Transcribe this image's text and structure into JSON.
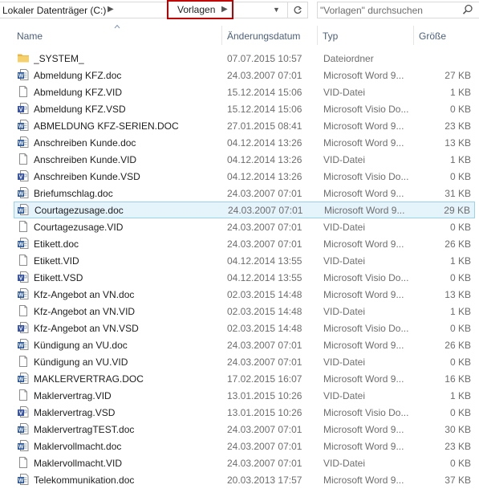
{
  "address": {
    "root_crumb": "Lokaler Datenträger (C:)",
    "current_crumb": "Vorlagen"
  },
  "search": {
    "placeholder": "\"Vorlagen\" durchsuchen"
  },
  "columns": {
    "name": "Name",
    "date": "Änderungsdatum",
    "type": "Typ",
    "size": "Größe"
  },
  "files": [
    {
      "name": "_SYSTEM_",
      "date": "07.07.2015 10:57",
      "type": "Dateiordner",
      "size": "",
      "icon": "folder-icon"
    },
    {
      "name": "Abmeldung KFZ.doc",
      "date": "24.03.2007 07:01",
      "type": "Microsoft Word 9...",
      "size": "27 KB",
      "icon": "word-doc-icon"
    },
    {
      "name": "Abmeldung KFZ.VID",
      "date": "15.12.2014 15:06",
      "type": "VID-Datei",
      "size": "1 KB",
      "icon": "blank-file-icon"
    },
    {
      "name": "Abmeldung KFZ.VSD",
      "date": "15.12.2014 15:06",
      "type": "Microsoft Visio Do...",
      "size": "0 KB",
      "icon": "visio-doc-icon"
    },
    {
      "name": "ABMELDUNG KFZ-SERIEN.DOC",
      "date": "27.01.2015 08:41",
      "type": "Microsoft Word 9...",
      "size": "23 KB",
      "icon": "word-doc-icon"
    },
    {
      "name": "Anschreiben Kunde.doc",
      "date": "04.12.2014 13:26",
      "type": "Microsoft Word 9...",
      "size": "13 KB",
      "icon": "word-doc-icon"
    },
    {
      "name": "Anschreiben Kunde.VID",
      "date": "04.12.2014 13:26",
      "type": "VID-Datei",
      "size": "1 KB",
      "icon": "blank-file-icon"
    },
    {
      "name": "Anschreiben Kunde.VSD",
      "date": "04.12.2014 13:26",
      "type": "Microsoft Visio Do...",
      "size": "0 KB",
      "icon": "visio-doc-icon"
    },
    {
      "name": "Briefumschlag.doc",
      "date": "24.03.2007 07:01",
      "type": "Microsoft Word 9...",
      "size": "31 KB",
      "icon": "word-doc-icon"
    },
    {
      "name": "Courtagezusage.doc",
      "date": "24.03.2007 07:01",
      "type": "Microsoft Word 9...",
      "size": "29 KB",
      "icon": "word-doc-icon",
      "selected": true
    },
    {
      "name": "Courtagezusage.VID",
      "date": "24.03.2007 07:01",
      "type": "VID-Datei",
      "size": "0 KB",
      "icon": "blank-file-icon"
    },
    {
      "name": "Etikett.doc",
      "date": "24.03.2007 07:01",
      "type": "Microsoft Word 9...",
      "size": "26 KB",
      "icon": "word-doc-icon"
    },
    {
      "name": "Etikett.VID",
      "date": "04.12.2014 13:55",
      "type": "VID-Datei",
      "size": "1 KB",
      "icon": "blank-file-icon"
    },
    {
      "name": "Etikett.VSD",
      "date": "04.12.2014 13:55",
      "type": "Microsoft Visio Do...",
      "size": "0 KB",
      "icon": "visio-doc-icon"
    },
    {
      "name": "Kfz-Angebot an VN.doc",
      "date": "02.03.2015 14:48",
      "type": "Microsoft Word 9...",
      "size": "13 KB",
      "icon": "word-doc-icon"
    },
    {
      "name": "Kfz-Angebot an VN.VID",
      "date": "02.03.2015 14:48",
      "type": "VID-Datei",
      "size": "1 KB",
      "icon": "blank-file-icon"
    },
    {
      "name": "Kfz-Angebot an VN.VSD",
      "date": "02.03.2015 14:48",
      "type": "Microsoft Visio Do...",
      "size": "0 KB",
      "icon": "visio-doc-icon"
    },
    {
      "name": "Kündigung an VU.doc",
      "date": "24.03.2007 07:01",
      "type": "Microsoft Word 9...",
      "size": "26 KB",
      "icon": "word-doc-icon"
    },
    {
      "name": "Kündigung an VU.VID",
      "date": "24.03.2007 07:01",
      "type": "VID-Datei",
      "size": "0 KB",
      "icon": "blank-file-icon"
    },
    {
      "name": "MAKLERVERTRAG.DOC",
      "date": "17.02.2015 16:07",
      "type": "Microsoft Word 9...",
      "size": "16 KB",
      "icon": "word-doc-icon"
    },
    {
      "name": "Maklervertrag.VID",
      "date": "13.01.2015 10:26",
      "type": "VID-Datei",
      "size": "1 KB",
      "icon": "blank-file-icon"
    },
    {
      "name": "Maklervertrag.VSD",
      "date": "13.01.2015 10:26",
      "type": "Microsoft Visio Do...",
      "size": "0 KB",
      "icon": "visio-doc-icon"
    },
    {
      "name": "MaklervertragTEST.doc",
      "date": "24.03.2007 07:01",
      "type": "Microsoft Word 9...",
      "size": "30 KB",
      "icon": "word-doc-icon"
    },
    {
      "name": "Maklervollmacht.doc",
      "date": "24.03.2007 07:01",
      "type": "Microsoft Word 9...",
      "size": "23 KB",
      "icon": "word-doc-icon"
    },
    {
      "name": "Maklervollmacht.VID",
      "date": "24.03.2007 07:01",
      "type": "VID-Datei",
      "size": "0 KB",
      "icon": "blank-file-icon"
    },
    {
      "name": "Telekommunikation.doc",
      "date": "20.03.2013 17:57",
      "type": "Microsoft Word 9...",
      "size": "37 KB",
      "icon": "word-doc-icon"
    }
  ],
  "colors": {
    "selection_bg": "#e5f3fb",
    "selection_border": "#99d1ef",
    "highlight_box": "#c00000",
    "header_text": "#4c607a"
  }
}
